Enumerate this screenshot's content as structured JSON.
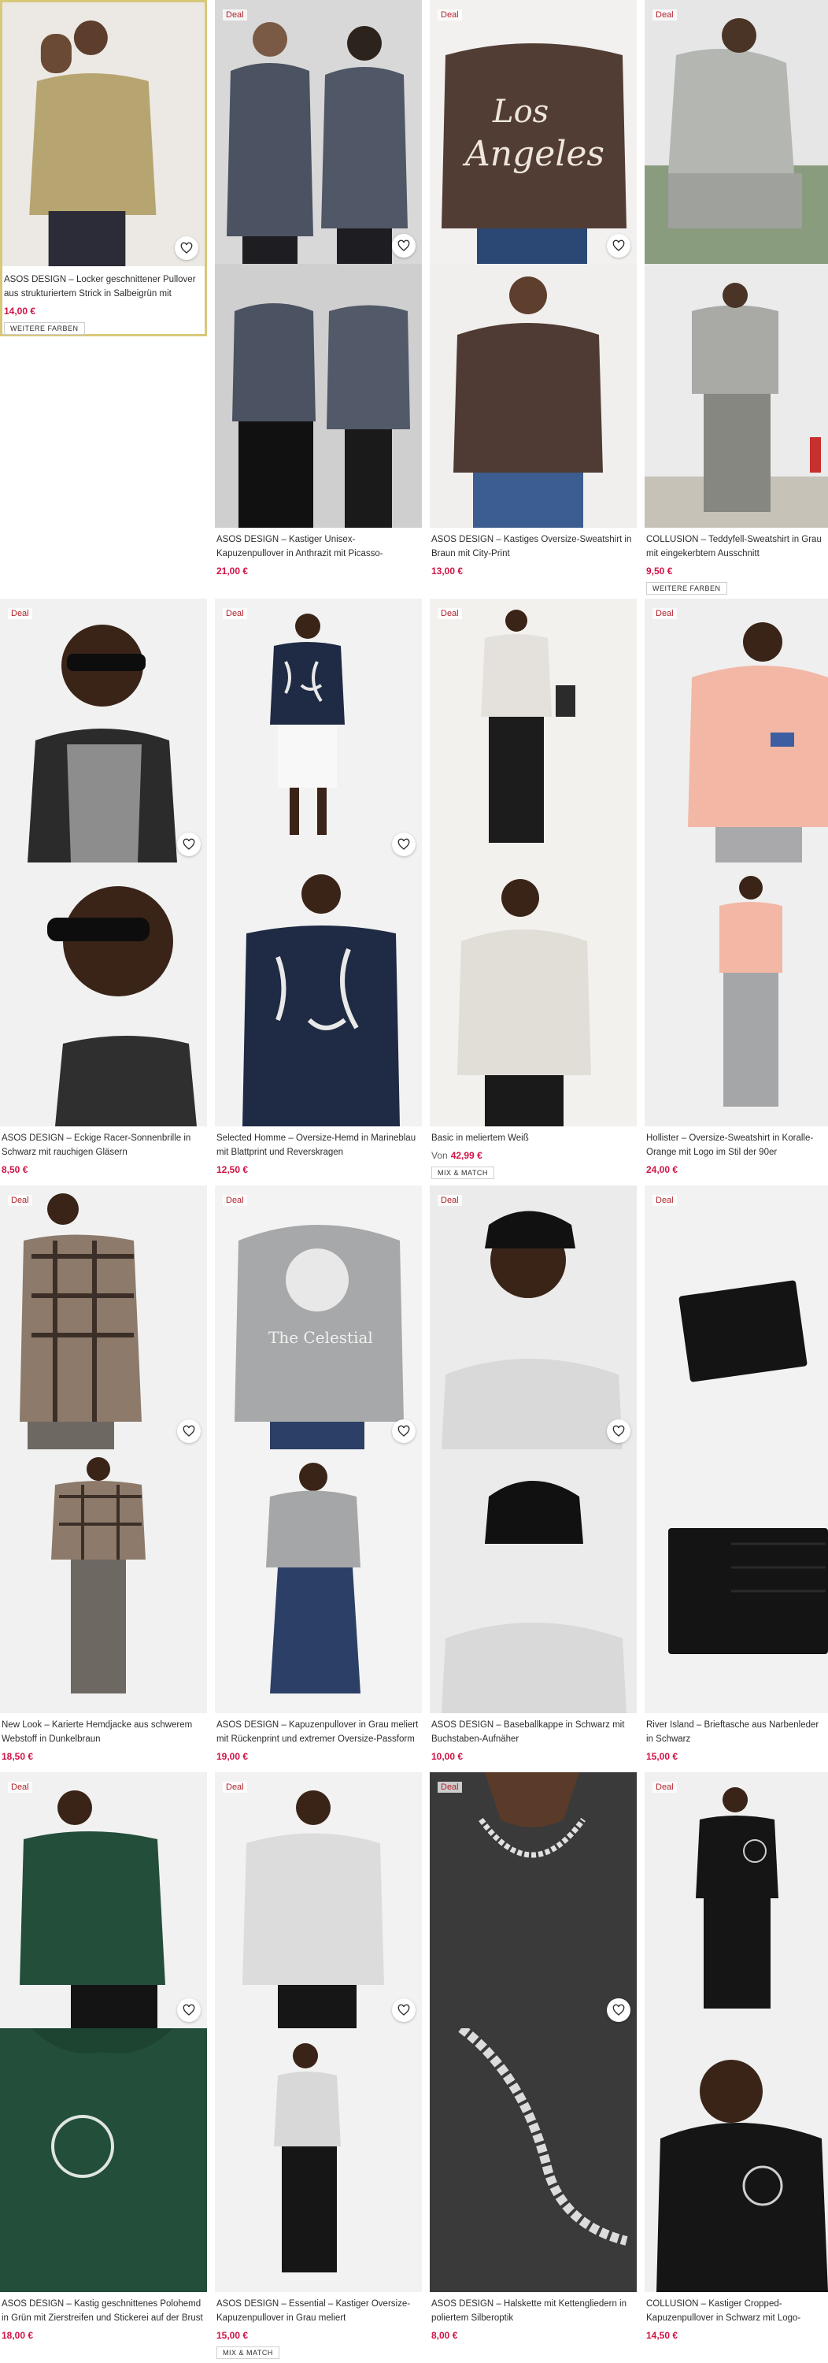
{
  "products": [
    {
      "id": "p1",
      "deal": "",
      "title": "ASOS DESIGN – Locker geschnittener Pullover aus strukturiertem Strick in Salbeigrün mit Polokragen ...",
      "price": "14,00 €",
      "price_prefix": "",
      "tag": "WEITERE FARBEN",
      "highlight": true,
      "images": [
        "man in sage green knit polo sweater",
        "man in sage green knit polo sweater"
      ]
    },
    {
      "id": "p2",
      "deal": "Deal",
      "title": "ASOS DESIGN – Kastiger Unisex-Kapuzenpullover in Anthrazit mit Picasso-Linienzeichnung und...",
      "price": "21,00 €",
      "price_prefix": "",
      "tag": "",
      "images": [
        "couple in anthracite hoodies",
        "couple in anthracite hoodies back view"
      ]
    },
    {
      "id": "p3",
      "deal": "Deal",
      "title": "ASOS DESIGN – Kastiges Oversize-Sweatshirt in Braun mit City-Print",
      "price": "13,00 €",
      "price_prefix": "",
      "tag": "",
      "images": [
        "brown sweatshirt with Los Angeles print back",
        "man in brown sweatshirt"
      ]
    },
    {
      "id": "p4",
      "deal": "Deal",
      "title": "COLLUSION – Teddyfell-Sweatshirt in Grau mit eingekerbtem Ausschnitt",
      "price": "9,50 €",
      "price_prefix": "",
      "tag": "WEITERE FARBEN",
      "images": [
        "man in grey teddy sweatshirt sitting",
        "man in grey teddy sweatshirt standing"
      ]
    },
    {
      "id": "p5",
      "deal": "Deal",
      "title": "ASOS DESIGN – Eckige Racer-Sonnenbrille in Schwarz mit rauchigen Gläsern",
      "price": "8,50 €",
      "price_prefix": "",
      "tag": "",
      "images": [
        "man wearing black racer sunglasses",
        "man wearing black sunglasses side view"
      ]
    },
    {
      "id": "p6",
      "deal": "Deal",
      "title": "Selected Homme – Oversize-Hemd in Marineblau mit Blattprint und Reverskragen",
      "price": "12,50 €",
      "price_prefix": "",
      "tag": "",
      "images": [
        "man in navy leaf print shirt",
        "man in navy leaf print shirt close"
      ]
    },
    {
      "id": "p7",
      "deal": "Deal",
      "title": "Basic in meliertem Weiß",
      "price": "42,99 €",
      "price_prefix": "Von",
      "tag": "MIX & MATCH",
      "images": [
        "man in white marl hoodie",
        "man in white marl hoodie close"
      ]
    },
    {
      "id": "p8",
      "deal": "Deal",
      "title": "Hollister – Oversize-Sweatshirt in Koralle-Orange mit Logo im Stil der 90er",
      "price": "24,00 €",
      "price_prefix": "",
      "tag": "",
      "images": [
        "man in coral hoodie",
        "man in coral hoodie full body"
      ]
    },
    {
      "id": "p9",
      "deal": "Deal",
      "title": "New Look – Karierte Hemdjacke aus schwerem Webstoff in Dunkelbraun",
      "price": "18,50 €",
      "price_prefix": "",
      "tag": "",
      "images": [
        "man in brown check overshirt",
        "man in brown check overshirt full"
      ]
    },
    {
      "id": "p10",
      "deal": "Deal",
      "title": "ASOS DESIGN – Kapuzenpullover in Grau meliert mit Rückenprint und extremer Oversize-Passform",
      "price": "19,00 €",
      "price_prefix": "",
      "tag": "",
      "images": [
        "grey hoodie with back print",
        "man in grey hoodie and wide jeans"
      ]
    },
    {
      "id": "p11",
      "deal": "Deal",
      "title": "ASOS DESIGN – Baseballkappe in Schwarz mit Buchstaben-Aufnäher",
      "price": "10,00 €",
      "price_prefix": "",
      "tag": "",
      "images": [
        "man in black baseball cap",
        "black baseball cap back view"
      ]
    },
    {
      "id": "p12",
      "deal": "Deal",
      "title": "River Island – Brieftasche aus Narbenleder in Schwarz",
      "price": "15,00 €",
      "price_prefix": "",
      "tag": "",
      "images": [
        "black grained leather wallet",
        "black wallet open"
      ]
    },
    {
      "id": "p13",
      "deal": "Deal",
      "title": "ASOS DESIGN – Kastig geschnittenes Polohemd in Grün mit Zierstreifen und Stickerei auf der Brust",
      "price": "18,00 €",
      "price_prefix": "",
      "tag": "",
      "images": [
        "man in green polo sweatshirt",
        "green polo embroidery close-up"
      ]
    },
    {
      "id": "p14",
      "deal": "Deal",
      "title": "ASOS DESIGN – Essential – Kastiger Oversize-Kapuzenpullover in Grau meliert",
      "price": "15,00 €",
      "price_prefix": "",
      "tag": "MIX & MATCH",
      "images": [
        "man in grey marl hoodie",
        "man in grey marl hoodie full body"
      ]
    },
    {
      "id": "p15",
      "deal": "Deal",
      "title": "ASOS DESIGN – Halskette mit Kettengliedern in poliertem Silberoptik",
      "price": "8,00 €",
      "price_prefix": "",
      "tag": "",
      "images": [
        "silver chain necklace on charcoal top",
        "silver chain necklace close-up"
      ]
    },
    {
      "id": "p16",
      "deal": "Deal",
      "title": "COLLUSION – Kastiger Cropped-Kapuzenpullover in Schwarz mit Logo-Emblem",
      "price": "14,50 €",
      "price_prefix": "",
      "tag": "",
      "images": [
        "man in black cropped hoodie",
        "man in black hoodie close"
      ]
    }
  ],
  "icons": {
    "heart": "heart-outline-icon"
  },
  "colors": {
    "price": "#d01345",
    "deal": "#b0222b",
    "highlight_border": "#d8c87a"
  }
}
